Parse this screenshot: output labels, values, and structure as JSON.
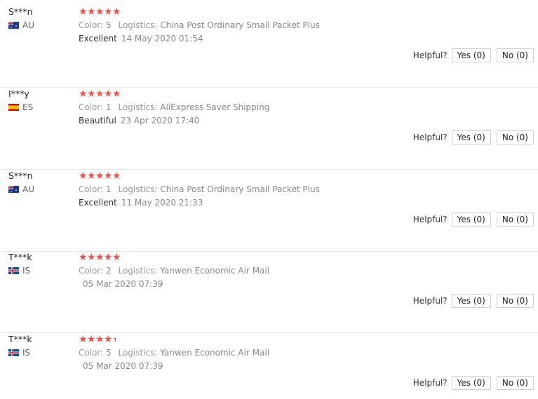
{
  "labels": {
    "color": "Color:",
    "logistics": "Logistics:",
    "helpful": "Helpful?"
  },
  "colors": {
    "star": "#f0504a",
    "separator": "#e8e8e8"
  },
  "reviews": [
    {
      "user": "S***n",
      "country": "AU",
      "flag_icon": "flag-australia-icon",
      "rating": 5,
      "color_value": "5",
      "logistics_value": "China Post Ordinary Small Packet Plus",
      "feedback": "Excellent",
      "date": "14 May 2020 01:54",
      "yes": "Yes (0)",
      "no": "No (0)"
    },
    {
      "user": "I***y",
      "country": "ES",
      "flag_icon": "flag-spain-icon",
      "rating": 5,
      "color_value": "1",
      "logistics_value": "AliExpress Saver Shipping",
      "feedback": "Beautiful",
      "date": "23 Apr 2020 17:40",
      "yes": "Yes (0)",
      "no": "No (0)"
    },
    {
      "user": "S***n",
      "country": "AU",
      "flag_icon": "flag-australia-icon",
      "rating": 5,
      "color_value": "1",
      "logistics_value": "China Post Ordinary Small Packet Plus",
      "feedback": "Excellent",
      "date": "11 May 2020 21:33",
      "yes": "Yes (0)",
      "no": "No (0)"
    },
    {
      "user": "T***k",
      "country": "IS",
      "flag_icon": "flag-iceland-icon",
      "rating": 5,
      "color_value": "2",
      "logistics_value": "Yanwen Economic Air Mail",
      "feedback": "",
      "date": "05 Mar 2020 07:39",
      "yes": "Yes (0)",
      "no": "No (0)"
    },
    {
      "user": "T***k",
      "country": "IS",
      "flag_icon": "flag-iceland-icon",
      "rating": 4.5,
      "color_value": "5",
      "logistics_value": "Yanwen Economic Air Mail",
      "feedback": "",
      "date": "05 Mar 2020 07:39",
      "yes": "Yes (0)",
      "no": "No (0)"
    }
  ]
}
